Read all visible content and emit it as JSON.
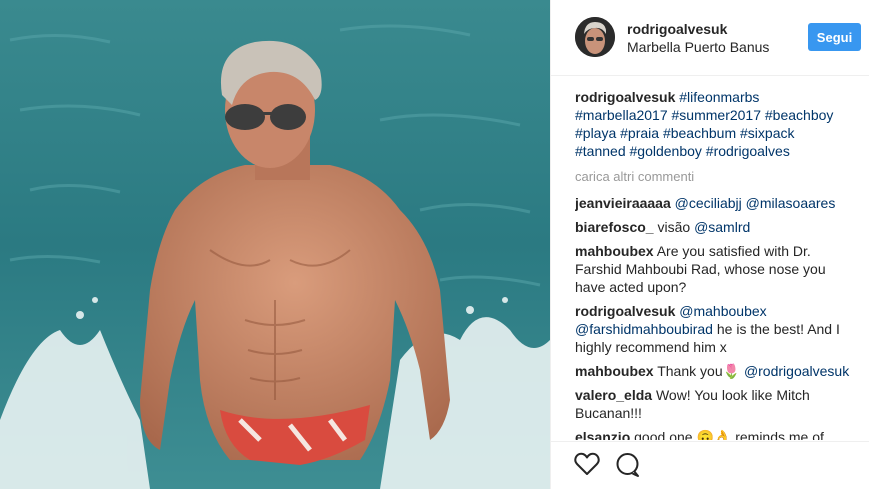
{
  "post": {
    "username": "rodrigoalvesuk",
    "location": "Marbella Puerto Banus",
    "follow_label": "Segui",
    "caption": {
      "user": "rodrigoalvesuk",
      "tags_line1": "#lifeonmarbs",
      "tags_line2": "#marbella2017 #summer2017 #beachboy",
      "tags_line3": "#playa #praia #beachbum #sixpack",
      "tags_line4": "#tanned #goldenboy #rodrigoalves"
    },
    "load_more": "carica altri commenti",
    "comments": [
      {
        "user": "jeanvieiraaaaa",
        "text": "@ceciliabjj @milasoaares"
      },
      {
        "user": "biarefosco_",
        "text": "visão @samlrd"
      },
      {
        "user": "mahboubex",
        "text": "Are you satisfied with Dr. Farshid Mahboubi Rad, whose nose you have acted upon?"
      },
      {
        "user": "rodrigoalvesuk",
        "text": "@mahboubex @farshidmahboubirad he is the best! And I highly recommend him x"
      },
      {
        "user": "mahboubex",
        "text": "Thank you🌷 @rodrigoalvesuk"
      },
      {
        "user": "valero_elda",
        "text": "Wow! You look like Mitch Bucanan!!!"
      },
      {
        "user": "elsanzio",
        "text": "good one 🙃👌 reminds me of"
      }
    ]
  },
  "icons": {
    "like": "heart-icon",
    "comment": "comment-bubble-icon"
  },
  "colors": {
    "follow_button": "#3897f0",
    "hashtag": "#003569",
    "sea": "#2f7d85"
  }
}
